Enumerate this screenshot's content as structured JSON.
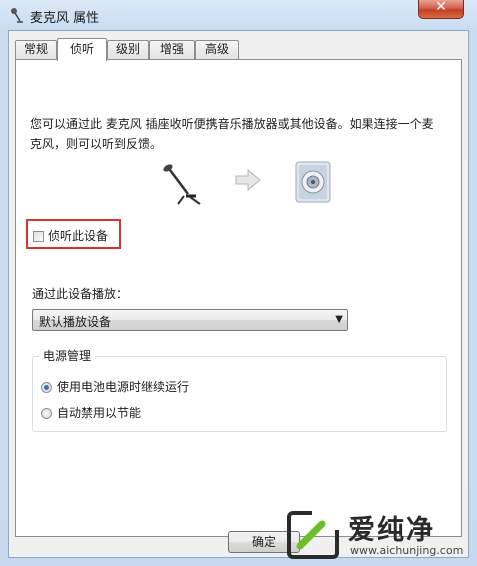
{
  "window": {
    "title": "麦克风 属性",
    "close_label": "✕"
  },
  "tabs": [
    {
      "label": "常规",
      "active": false
    },
    {
      "label": "侦听",
      "active": true
    },
    {
      "label": "级别",
      "active": false
    },
    {
      "label": "增强",
      "active": false
    },
    {
      "label": "高级",
      "active": false
    }
  ],
  "listen": {
    "description_line1": "您可以通过此 麦克风 插座收听便携音乐播放器或其他设备。如果连接一个麦",
    "description_line2": "克风，则可以听到反馈。",
    "listen_checkbox_label": "侦听此设备",
    "listen_checked": false,
    "playback_label": "通过此设备播放：",
    "playback_device": "默认播放设备",
    "power_group_title": "电源管理",
    "power_options": [
      {
        "label": "使用电池电源时继续运行",
        "selected": true
      },
      {
        "label": "自动禁用以节能",
        "selected": false
      }
    ]
  },
  "buttons": {
    "ok": "确定"
  },
  "icons": {
    "title": "microphone-icon",
    "source": "microphone-icon",
    "arrow": "arrow-right-icon",
    "target": "speaker-icon"
  },
  "watermark": {
    "text": "爱纯净",
    "url": "www.aichunjing.com"
  },
  "colors": {
    "highlight_border": "#d9342b",
    "radio_dot": "#3a6fb8",
    "close_button": "#c2401f"
  }
}
